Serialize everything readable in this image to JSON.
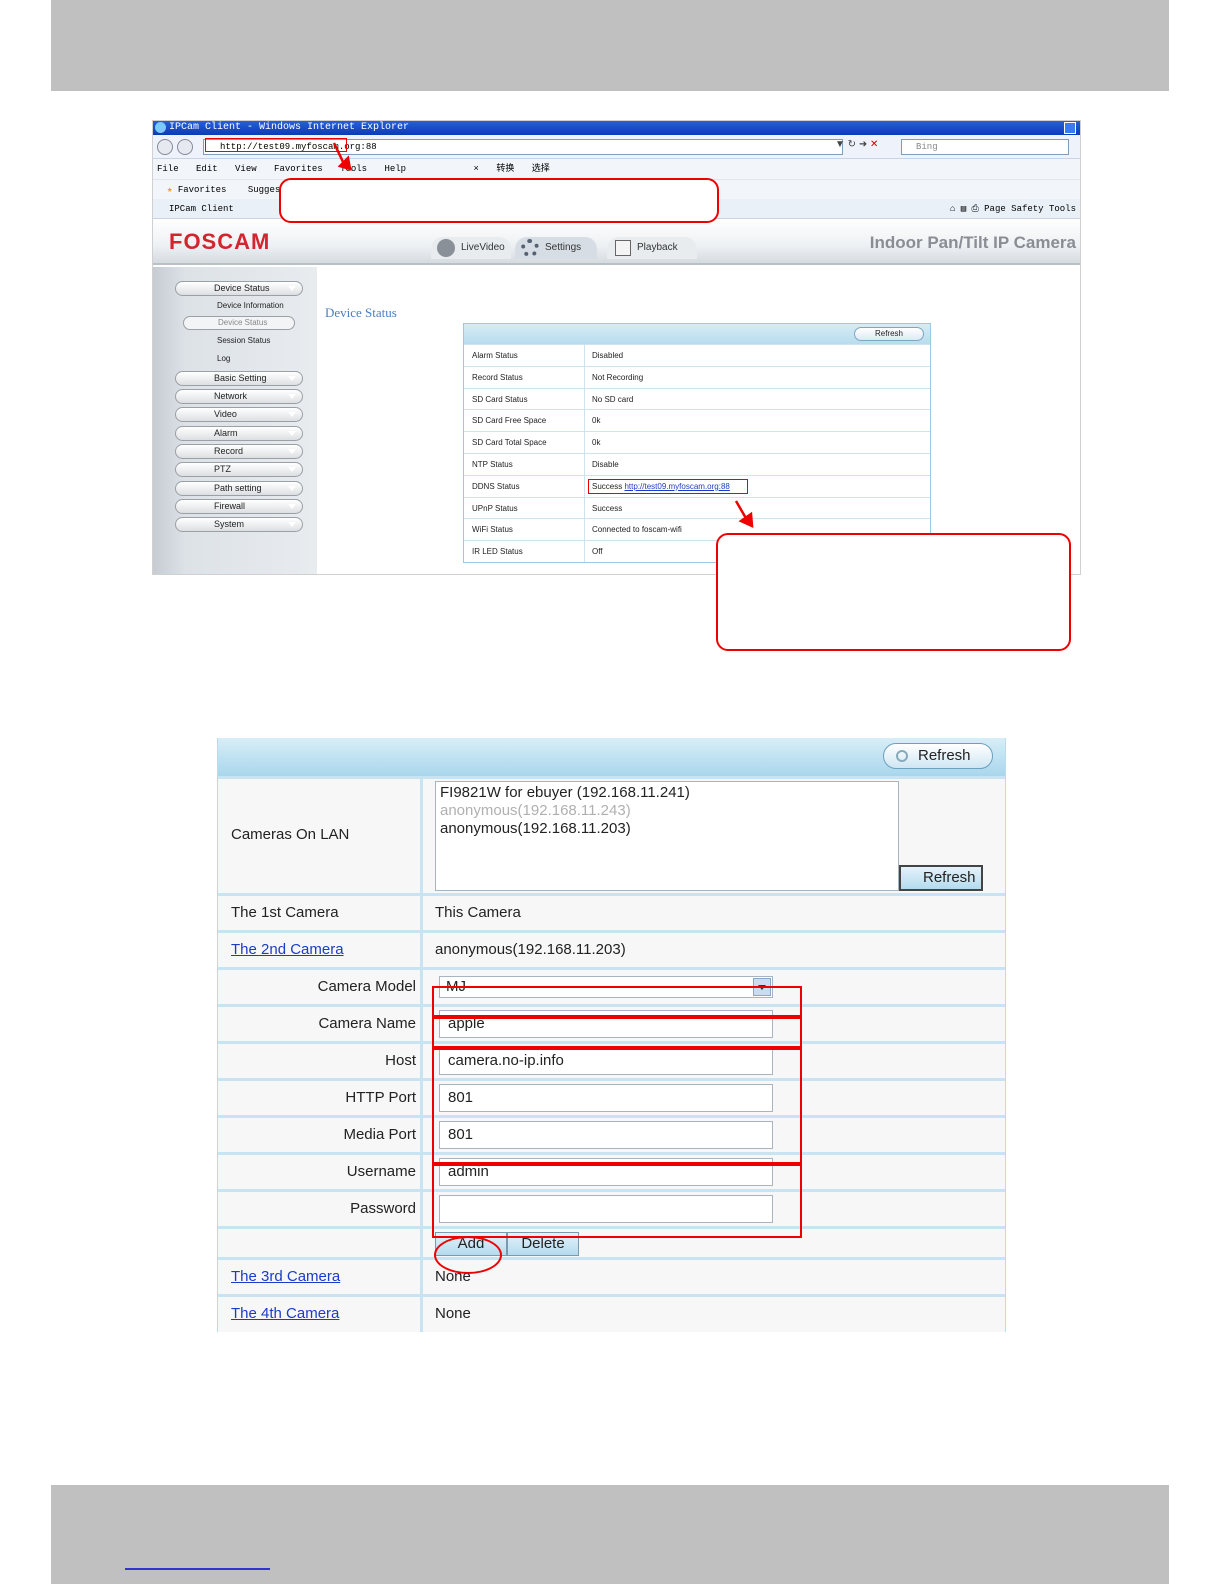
{
  "browser": {
    "title": "IPCam Client - Windows Internet Explorer",
    "address": "http://test09.myfoscam.org:88",
    "search_placeholder": "Bing",
    "menu": [
      "File",
      "Edit",
      "View",
      "Favorites",
      "Tools",
      "Help"
    ],
    "toolbar_extra": [
      "转换",
      "选择"
    ],
    "favorites_label": "Favorites",
    "suggested_label": "Suggested",
    "tab_label": "IPCam Client",
    "tools": [
      "Page",
      "Safety",
      "Tools"
    ]
  },
  "app": {
    "logo": "FOSCAM",
    "tabs": [
      "LiveVideo",
      "Settings",
      "Playback"
    ],
    "camera_title": "Indoor Pan/Tilt IP Camera",
    "sidebar": {
      "top_menu": "Device Status",
      "sub_items": [
        "Device Information",
        "Device Status",
        "Session Status",
        "Log"
      ],
      "menus": [
        "Basic Setting",
        "Network",
        "Video",
        "Alarm",
        "Record",
        "PTZ",
        "Path setting",
        "Firewall",
        "System"
      ]
    },
    "section_title": "Device Status",
    "refresh_label": "Refresh",
    "status_rows": [
      {
        "key": "Alarm Status",
        "value": "Disabled"
      },
      {
        "key": "Record Status",
        "value": "Not Recording"
      },
      {
        "key": "SD Card Status",
        "value": "No SD card"
      },
      {
        "key": "SD Card Free Space",
        "value": "0k"
      },
      {
        "key": "SD Card Total Space",
        "value": "0k"
      },
      {
        "key": "NTP Status",
        "value": "Disable"
      },
      {
        "key": "DDNS Status",
        "value": "Success",
        "link": "http://test09.myfoscam.org:88"
      },
      {
        "key": "UPnP Status",
        "value": "Success"
      },
      {
        "key": "WiFi Status",
        "value": "Connected to foscam-wifi"
      },
      {
        "key": "IR LED Status",
        "value": "Off"
      }
    ]
  },
  "multi_device": {
    "refresh_top": "Refresh",
    "cameras_on_lan_label": "Cameras On LAN",
    "lan_list": [
      "FI9821W for ebuyer (192.168.11.241)",
      "anonymous(192.168.11.243)",
      "anonymous(192.168.11.203)"
    ],
    "lan_refresh": "Refresh",
    "first_camera_label": "The 1st Camera",
    "first_camera_value": "This Camera",
    "second_camera_label": "The 2nd Camera",
    "second_camera_value": "anonymous(192.168.11.203)",
    "fields": {
      "camera_model_label": "Camera Model",
      "camera_model_value": "MJ",
      "camera_name_label": "Camera Name",
      "camera_name_value": "apple",
      "host_label": "Host",
      "host_value": "camera.no-ip.info",
      "http_port_label": "HTTP Port",
      "http_port_value": "801",
      "media_port_label": "Media Port",
      "media_port_value": "801",
      "username_label": "Username",
      "username_value": "admin",
      "password_label": "Password",
      "password_value": ""
    },
    "add_label": "Add",
    "delete_label": "Delete",
    "third_camera_label": "The 3rd Camera",
    "third_camera_value": "None",
    "fourth_camera_label": "The 4th Camera",
    "fourth_camera_value": "None"
  },
  "colors": {
    "annotation_red": "#ee0000",
    "brand_red": "#d2262e",
    "link_blue": "#1a3cc8",
    "band_gray": "#c0c0c0"
  }
}
